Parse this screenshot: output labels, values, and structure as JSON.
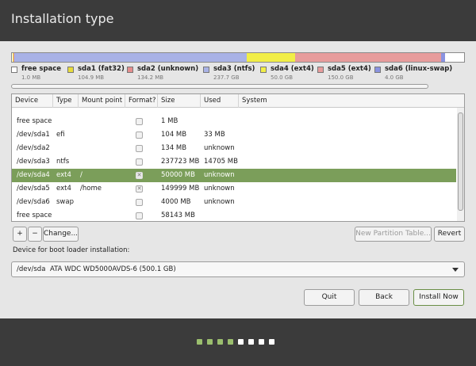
{
  "header": {
    "title": "Installation type"
  },
  "legend": [
    {
      "name": "free space",
      "size": "1.0 MB",
      "color": "#ffffff"
    },
    {
      "name": "sda1 (fat32)",
      "size": "104.9 MB",
      "color": "#e8dc3c"
    },
    {
      "name": "sda2 (unknown)",
      "size": "134.2 MB",
      "color": "#e58e8e"
    },
    {
      "name": "sda3 (ntfs)",
      "size": "237.7 GB",
      "color": "#a9b2e6"
    },
    {
      "name": "sda4 (ext4)",
      "size": "50.0 GB",
      "color": "#f1ee47"
    },
    {
      "name": "sda5 (ext4)",
      "size": "150.0 GB",
      "color": "#e79c9c"
    },
    {
      "name": "sda6 (linux-swap)",
      "size": "4.0 GB",
      "color": "#8a93e0"
    }
  ],
  "table": {
    "columns": [
      "Device",
      "Type",
      "Mount point",
      "Format?",
      "Size",
      "Used",
      "System"
    ],
    "rows": [
      {
        "device": "free space",
        "type": "",
        "mount": "",
        "format": false,
        "size": "1 MB",
        "used": ""
      },
      {
        "device": "/dev/sda1",
        "type": "efi",
        "mount": "",
        "format": false,
        "size": "104 MB",
        "used": "33 MB"
      },
      {
        "device": "/dev/sda2",
        "type": "",
        "mount": "",
        "format": false,
        "size": "134 MB",
        "used": "unknown"
      },
      {
        "device": "/dev/sda3",
        "type": "ntfs",
        "mount": "",
        "format": false,
        "size": "237723 MB",
        "used": "14705 MB"
      },
      {
        "device": "/dev/sda4",
        "type": "ext4",
        "mount": "/",
        "format": true,
        "size": "50000 MB",
        "used": "unknown",
        "selected": true
      },
      {
        "device": "/dev/sda5",
        "type": "ext4",
        "mount": "/home",
        "format": true,
        "size": "149999 MB",
        "used": "unknown"
      },
      {
        "device": "/dev/sda6",
        "type": "swap",
        "mount": "",
        "format": false,
        "size": "4000 MB",
        "used": "unknown"
      },
      {
        "device": "free space",
        "type": "",
        "mount": "",
        "format": false,
        "size": "58143 MB",
        "used": ""
      }
    ]
  },
  "toolbar": {
    "add_label": "+",
    "remove_label": "−",
    "change_label": "Change...",
    "new_table_label": "New Partition Table...",
    "revert_label": "Revert"
  },
  "bootloader": {
    "label": "Device for boot loader installation:",
    "device": "/dev/sda",
    "description": "ATA WDC WD5000AVDS-6 (500.1 GB)"
  },
  "actions": {
    "quit_label": "Quit",
    "back_label": "Back",
    "install_label": "Install Now"
  },
  "progress": {
    "completed_steps": 4,
    "total_steps": 8,
    "active_color": "#9bbf6e",
    "inactive_color": "#ffffff"
  }
}
